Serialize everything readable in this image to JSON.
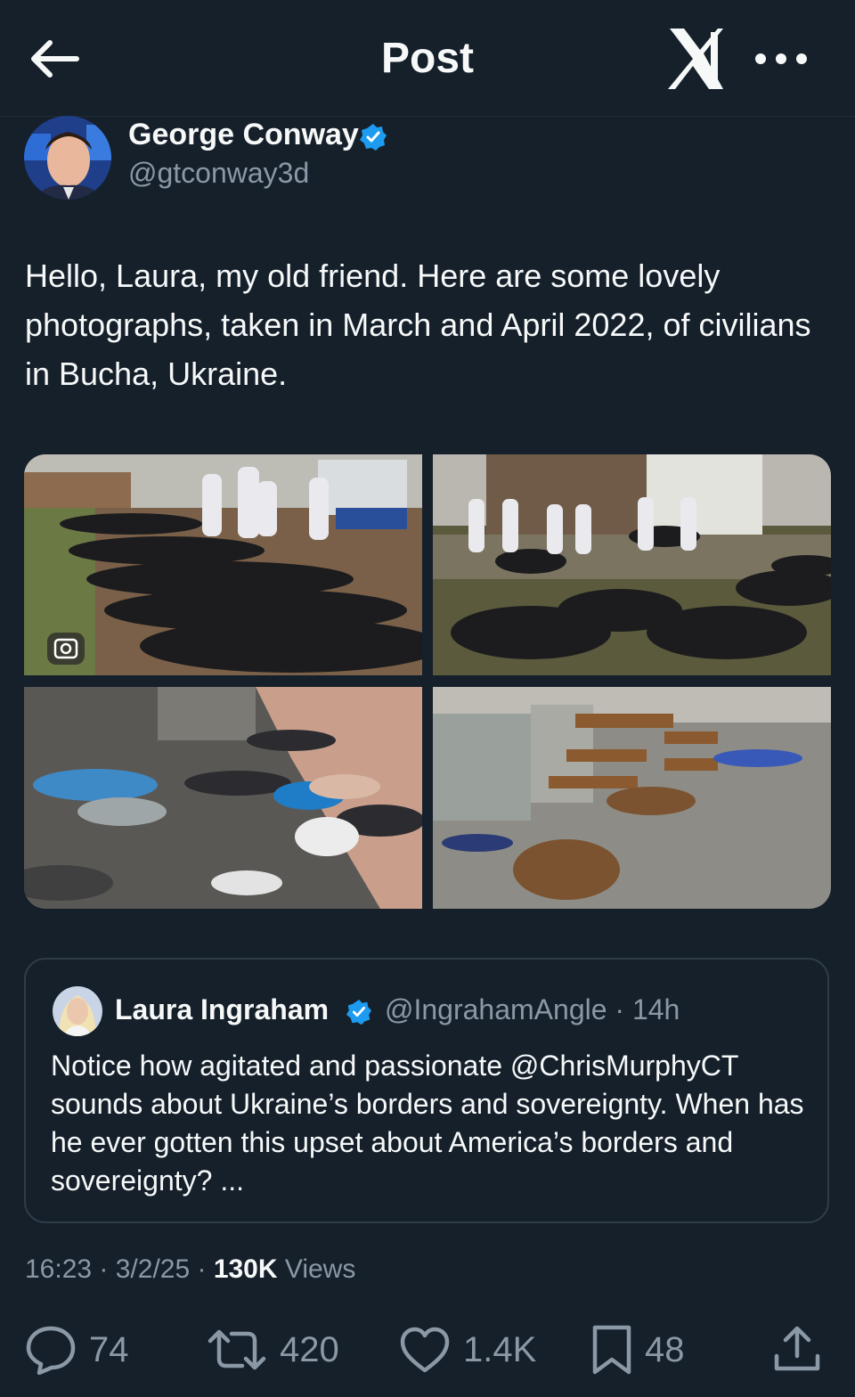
{
  "header": {
    "title": "Post"
  },
  "author": {
    "name": "George Conway",
    "handle": "@gtconway3d"
  },
  "post": {
    "text": "Hello, Laura, my old friend.  Here are some lovely photographs, taken in March and April 2022, of civilians in Bucha, Ukraine."
  },
  "quoted": {
    "name": "Laura Ingraham",
    "meta": "@IngrahamAngle · 14h",
    "text": "Notice how agitated and passionate @ChrisMurphyCT sounds about Ukraine’s borders and sovereignty. When has he ever gotten this upset about America’s borders and sovereignty? ..."
  },
  "stamp": {
    "time_date": "16:23 · 3/2/25 · ",
    "views_count": "130K",
    "views_label": " Views"
  },
  "actions": {
    "replies": "74",
    "reposts": "420",
    "likes": "1.4K",
    "bookmarks": "48"
  },
  "icons": [
    "back-arrow-icon",
    "x-logo-icon",
    "more-icon",
    "verified-badge-icon",
    "lens-icon",
    "reply-icon",
    "repost-icon",
    "like-icon",
    "bookmark-icon",
    "share-icon"
  ],
  "colors": {
    "background": "#15202b",
    "text": "#f7f9f9",
    "muted": "#8b98a5",
    "verified": "#1d9bf0",
    "border": "#2f3b47"
  }
}
